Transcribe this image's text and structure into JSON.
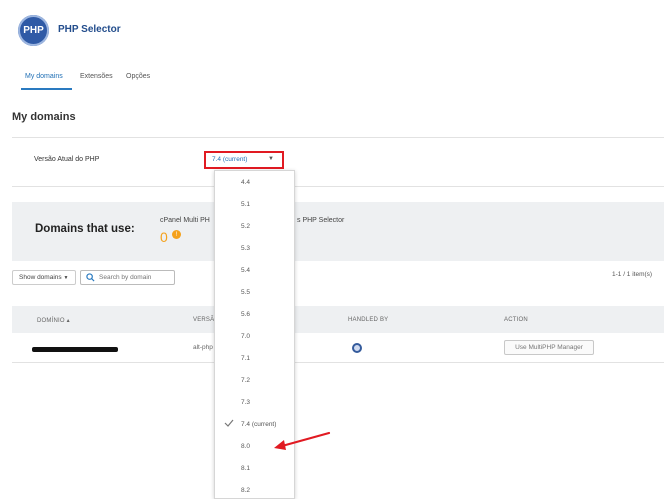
{
  "header": {
    "logo_text": "PHP",
    "title": "PHP Selector"
  },
  "tabs": [
    {
      "label": "My domains",
      "active": true
    },
    {
      "label": "Extensões",
      "active": false
    },
    {
      "label": "Opções",
      "active": false
    }
  ],
  "section_title": "My domains",
  "php_version": {
    "label": "Versão Atual do PHP",
    "selected": "7.4 (current)",
    "options": [
      "4.4",
      "5.1",
      "5.2",
      "5.3",
      "5.4",
      "5.5",
      "5.6",
      "7.0",
      "7.1",
      "7.2",
      "7.3",
      "7.4 (current)",
      "8.0",
      "8.1",
      "8.2"
    ],
    "highlight_color": "#e11a22"
  },
  "usage": {
    "heading": "Domains that use:",
    "multi_label": "cPanel Multi PH",
    "selector_label": "s PHP Selector",
    "multi_count": "0",
    "info_glyph": "!"
  },
  "filters": {
    "show_domains_label": "Show domains",
    "search_placeholder": "Search by domain",
    "pagination": "1-1 / 1 item(s)"
  },
  "table": {
    "columns": [
      "DOMÍNIO",
      "VERSÃ",
      "HANDLED BY",
      "ACTION"
    ],
    "rows": [
      {
        "version": "alt-php",
        "action": "Use MultiPHP Manager"
      }
    ]
  },
  "colors": {
    "accent": "#2a7ac0",
    "warning": "#f4a11c",
    "annotation": "#e11a22"
  }
}
